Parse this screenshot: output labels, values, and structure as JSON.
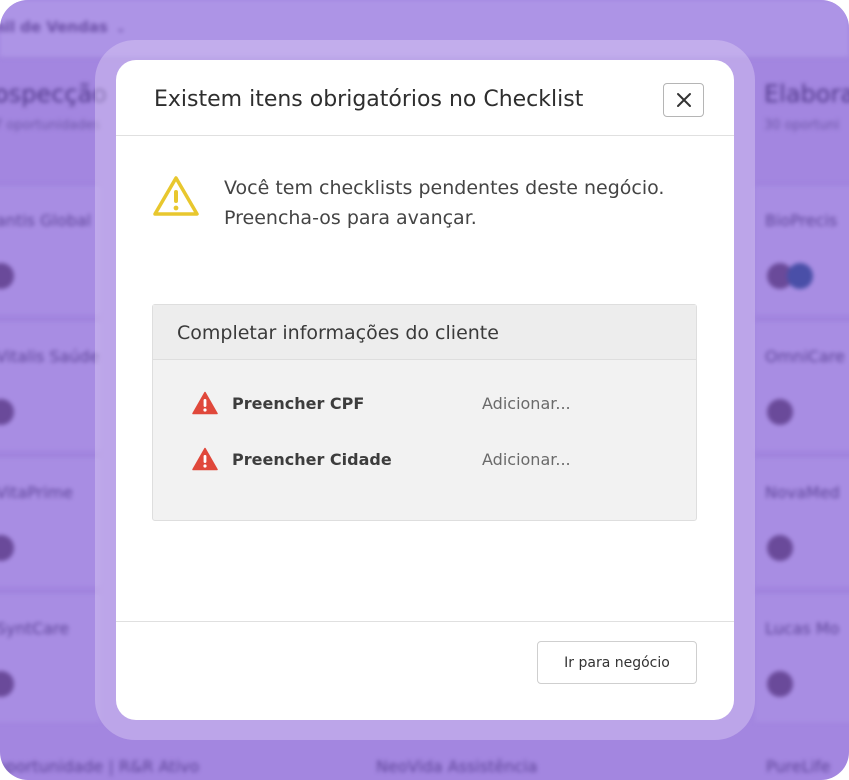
{
  "background": {
    "funnel_label": "nil de Vendas",
    "left_column": {
      "title": "ospecção",
      "subtitle": "7 oportunidades",
      "cards": [
        "antis Global",
        "Vitalis Saúde",
        "VitaPrime",
        "SyntCare"
      ],
      "bottom": "oportunidade | R&R Ativo"
    },
    "right_column": {
      "title": "Elabora",
      "subtitle": "30 oportuni",
      "cards": [
        "BioPrecis",
        "OmniCare",
        "NovaMed",
        "Lucas Mo"
      ],
      "bottom": "PureLife"
    },
    "middle_bottom": "NeoVida Assistência"
  },
  "modal": {
    "title": "Existem itens obrigatórios no Checklist",
    "warning_line1": "Você tem checklists pendentes deste negócio.",
    "warning_line2": "Preencha-os para avançar.",
    "checklist": {
      "title": "Completar informações do cliente",
      "items": [
        {
          "label": "Preencher CPF",
          "action": "Adicionar..."
        },
        {
          "label": "Preencher Cidade",
          "action": "Adicionar..."
        }
      ]
    },
    "footer_button": "Ir para negócio"
  },
  "colors": {
    "warning_yellow": "#e8c72e",
    "alert_red": "#e0483b",
    "background_purple": "#a386e0"
  },
  "icons": {
    "close": "close-icon",
    "warning": "warning-triangle-icon",
    "alert": "alert-triangle-icon",
    "funnel_dropdown": "chevron-down-icon"
  }
}
